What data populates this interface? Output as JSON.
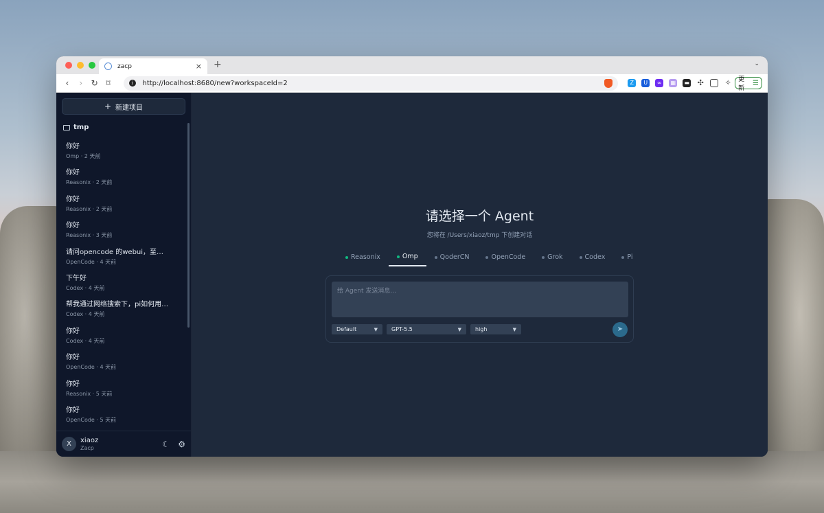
{
  "browser": {
    "tab_title": "zacp",
    "new_tab": "+",
    "close_tab": "×",
    "url": "http://localhost:8680/new?workspaceId=2",
    "update_label": "更新"
  },
  "sidebar": {
    "new_project_label": "新建项目",
    "folder": "tmp",
    "conversations": [
      {
        "title": "你好",
        "meta": "Omp · 2 天前"
      },
      {
        "title": "你好",
        "meta": "Reasonix · 2 天前"
      },
      {
        "title": "你好",
        "meta": "Reasonix · 2 天前"
      },
      {
        "title": "你好",
        "meta": "Reasonix · 3 天前"
      },
      {
        "title": "请问opencode 的webui，至多多...",
        "meta": "OpenCode · 4 天前"
      },
      {
        "title": "下午好",
        "meta": "Codex · 4 天前"
      },
      {
        "title": "帮我通过网络搜索下，pi如何用a...",
        "meta": "Codex · 4 天前"
      },
      {
        "title": "你好",
        "meta": "Codex · 4 天前"
      },
      {
        "title": "你好",
        "meta": "OpenCode · 4 天前"
      },
      {
        "title": "你好",
        "meta": "Reasonix · 5 天前"
      },
      {
        "title": "你好",
        "meta": "OpenCode · 5 天前"
      }
    ],
    "user": {
      "avatar_letter": "X",
      "name": "xiaoz",
      "subtitle": "Zacp"
    }
  },
  "main": {
    "heading": "请选择一个 Agent",
    "subheading": "您将在 /Users/xiaoz/tmp 下创建对话",
    "agents": [
      {
        "label": "Reasonix",
        "status": "online"
      },
      {
        "label": "Omp",
        "status": "online",
        "active": true
      },
      {
        "label": "QoderCN",
        "status": "offline"
      },
      {
        "label": "OpenCode",
        "status": "offline"
      },
      {
        "label": "Grok",
        "status": "offline"
      },
      {
        "label": "Codex",
        "status": "offline"
      },
      {
        "label": "Pi",
        "status": "offline"
      }
    ],
    "composer": {
      "placeholder": "给 Agent 发送消息...",
      "mode": "Default",
      "model": "GPT-5.5",
      "effort": "high"
    }
  },
  "colors": {
    "sidebar_bg": "#0f172a",
    "main_bg": "#1e293b",
    "online_dot": "#10b981",
    "send_button": "#2b6a8c"
  }
}
